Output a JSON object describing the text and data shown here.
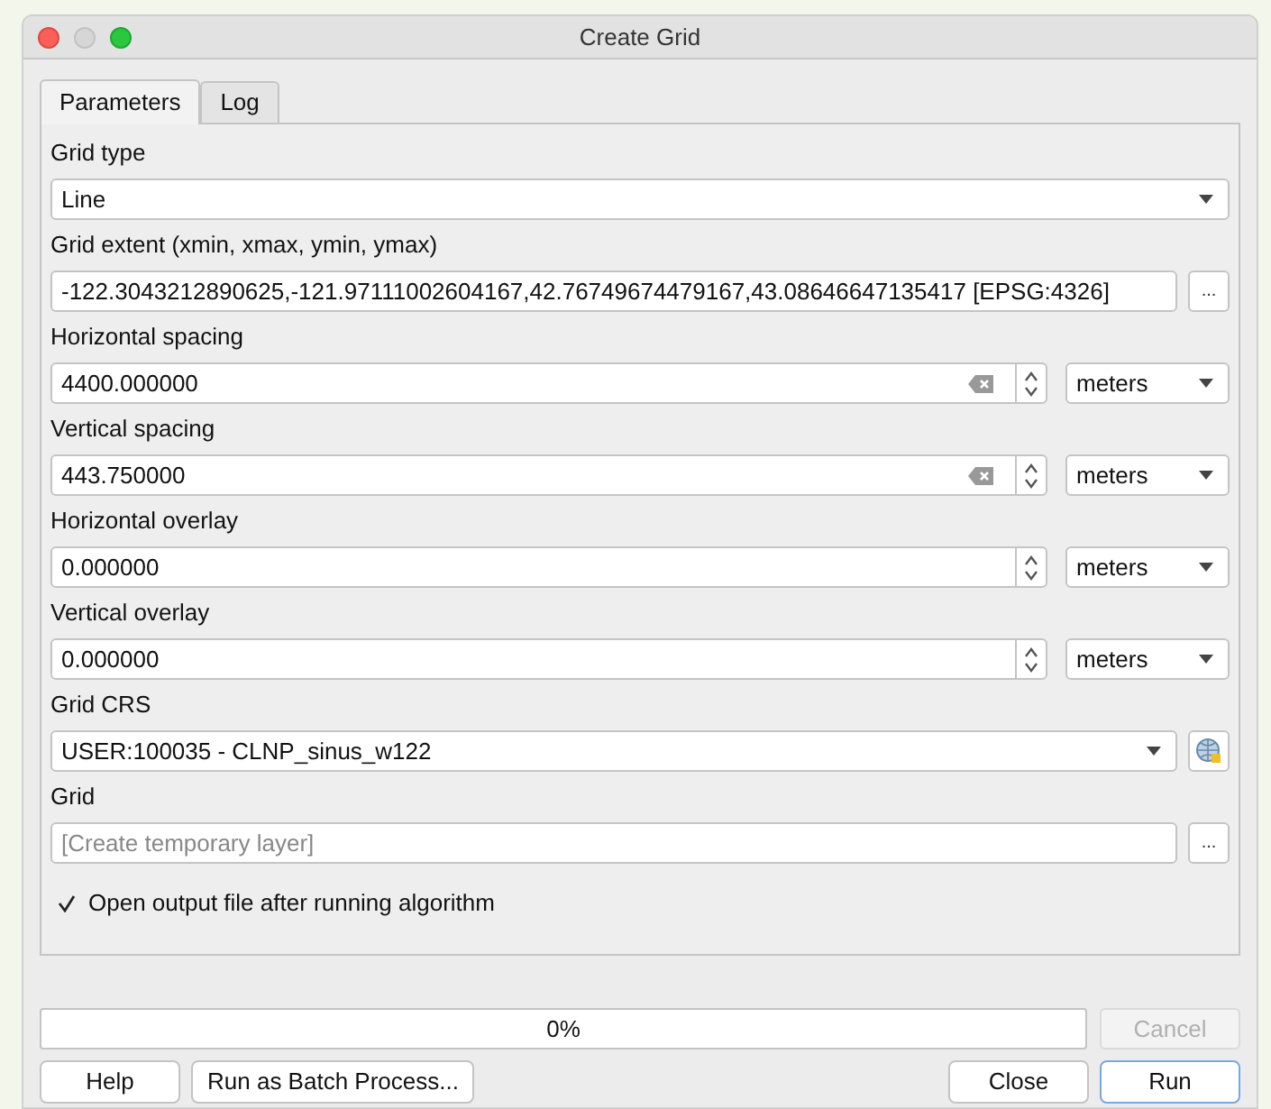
{
  "window": {
    "title": "Create Grid"
  },
  "tabs": [
    {
      "label": "Parameters",
      "selected": true
    },
    {
      "label": "Log",
      "selected": false
    }
  ],
  "params": [
    {
      "label": "Grid type",
      "kind": "combo",
      "value": "Line"
    },
    {
      "label": "Grid extent (xmin, xmax, ymin, ymax)",
      "kind": "extent",
      "value": "-122.3043212890625,-121.97111002604167,42.76749674479167,43.08646647135417 [EPSG:4326]",
      "button": "..."
    },
    {
      "label": "Horizontal spacing",
      "kind": "spin",
      "value": "4400.000000",
      "clearable": true,
      "unit": "meters"
    },
    {
      "label": "Vertical spacing",
      "kind": "spin",
      "value": "443.750000",
      "clearable": true,
      "unit": "meters"
    },
    {
      "label": "Horizontal overlay",
      "kind": "spin",
      "value": "0.000000",
      "clearable": false,
      "unit": "meters"
    },
    {
      "label": "Vertical overlay",
      "kind": "spin",
      "value": "0.000000",
      "clearable": false,
      "unit": "meters"
    },
    {
      "label": "Grid CRS",
      "kind": "crs",
      "value": "USER:100035 - CLNP_sinus_w122"
    },
    {
      "label": "Grid",
      "kind": "file",
      "placeholder": "[Create temporary layer]",
      "button": "..."
    }
  ],
  "open_output": {
    "label": "Open output file after running algorithm",
    "checked": true
  },
  "progress": {
    "text": "0%",
    "level": 0
  },
  "cancel": {
    "label": "Cancel",
    "disabled": true
  },
  "buttons": [
    {
      "label": "Help",
      "default": false
    },
    {
      "label": "Run as Batch Process...",
      "default": false
    },
    {
      "label": "Close",
      "default": false
    },
    {
      "label": "Run",
      "default": true
    }
  ]
}
